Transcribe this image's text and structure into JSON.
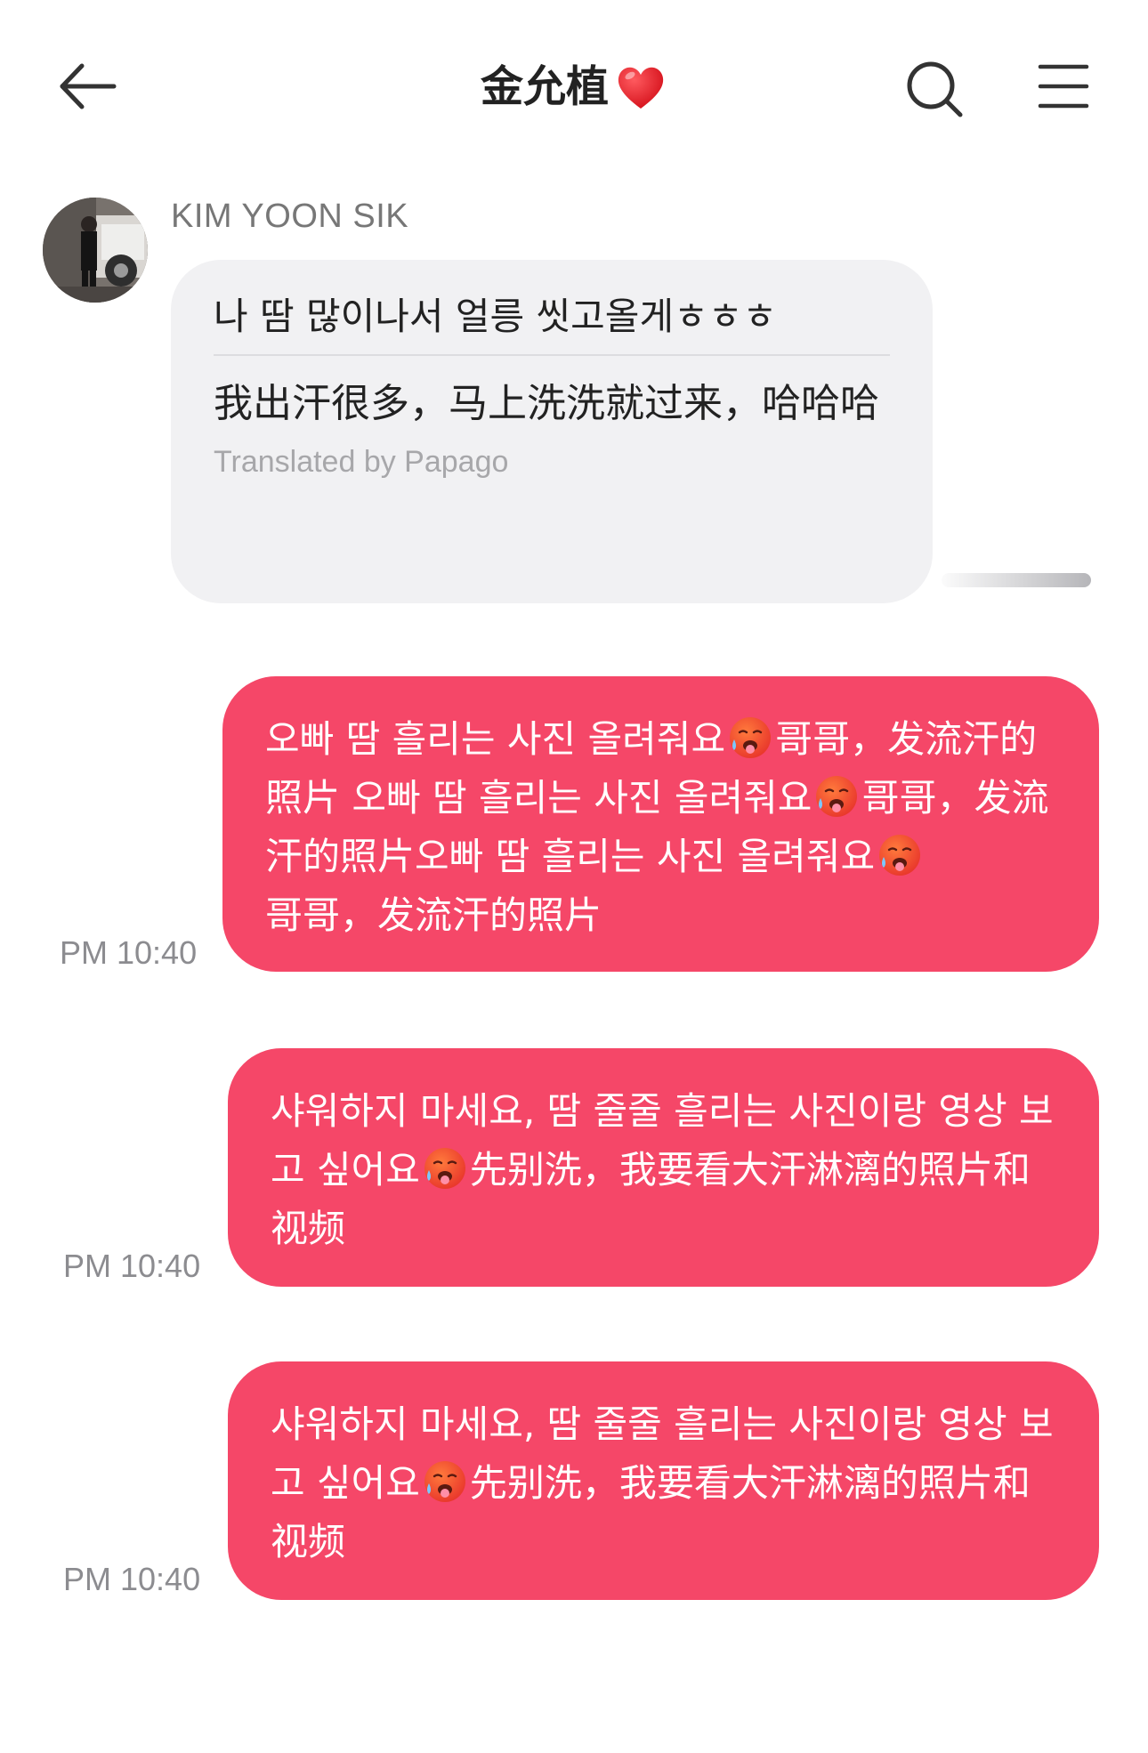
{
  "header": {
    "title": "金允植",
    "back_icon": "arrow-left-icon",
    "heart_icon": "red-heart-icon",
    "search_icon": "search-icon",
    "menu_icon": "hamburger-menu-icon"
  },
  "incoming": {
    "sender_name": "KIM YOON SIK",
    "original_text": "나 땀 많이나서 얼릉 씻고올게ㅎㅎㅎ",
    "translation_text": "我出汗很多，马上洗洗就过来，哈哈哈",
    "translated_by": "Translated by Papago"
  },
  "outgoing": [
    {
      "segments": [
        "오빠 땀 흘리는 사진 올려줘요",
        "哥哥，发流汗的照片 오빠 땀 흘리는 사진 올려줘요",
        "哥哥，发流汗的照片오빠 땀 흘리는 사진 올려줘요",
        "哥哥，发流汗的照片"
      ],
      "time": "PM 10:40"
    },
    {
      "segments": [
        "샤워하지 마세요, 땀 줄줄 흘리는 사진이랑 영상 보고 싶어요",
        "先别洗，我要看大汗淋漓的照片和视频"
      ],
      "time": "PM 10:40"
    },
    {
      "segments": [
        "샤워하지 마세요, 땀 줄줄 흘리는 사진이랑 영상 보고 싶어요",
        "先别洗，我要看大汗淋漓的照片和视频"
      ],
      "time": "PM 10:40"
    }
  ],
  "emoji_name": "hot-face-sweat-emoji",
  "colors": {
    "outgoing_bubble": "#f54768",
    "incoming_bubble": "#f1f1f3",
    "background": "#ffffff"
  }
}
